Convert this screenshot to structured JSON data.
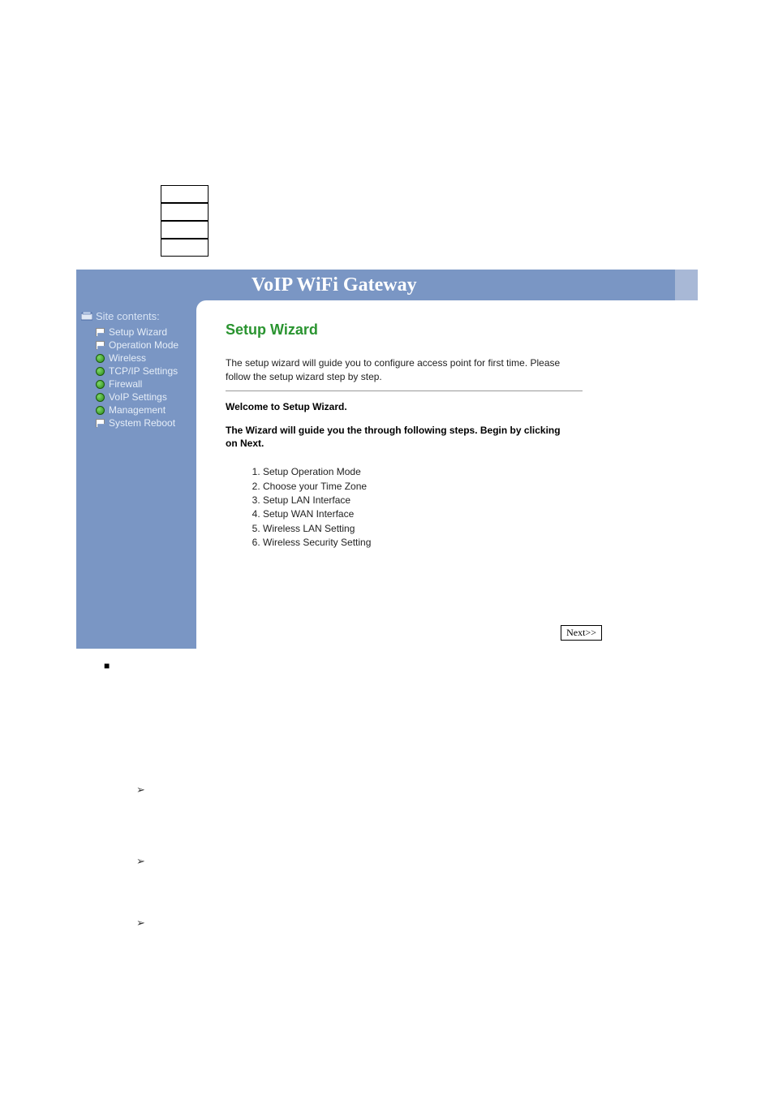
{
  "header": {
    "title": "VoIP WiFi Gateway"
  },
  "sidebar": {
    "title": "Site contents:",
    "items": [
      {
        "label": "Setup Wizard",
        "icon": "flag"
      },
      {
        "label": "Operation Mode",
        "icon": "flag"
      },
      {
        "label": "Wireless",
        "icon": "globe"
      },
      {
        "label": "TCP/IP Settings",
        "icon": "globe"
      },
      {
        "label": "Firewall",
        "icon": "globe"
      },
      {
        "label": "VoIP Settings",
        "icon": "globe"
      },
      {
        "label": "Management",
        "icon": "globe"
      },
      {
        "label": "System Reboot",
        "icon": "flag"
      }
    ]
  },
  "main": {
    "page_title": "Setup Wizard",
    "intro": "The setup wizard will guide you to configure access point for first time. Please follow the setup wizard step by step.",
    "welcome": "Welcome to Setup Wizard.",
    "guide": "The Wizard will guide you the through following steps. Begin by clicking on Next.",
    "steps": [
      "Setup Operation Mode",
      "Choose your Time Zone",
      "Setup LAN Interface",
      "Setup WAN Interface",
      "Wireless LAN Setting",
      "Wireless Security Setting"
    ],
    "next_label": "Next>>"
  },
  "decor": {
    "square": "■",
    "arrow": "➢"
  }
}
